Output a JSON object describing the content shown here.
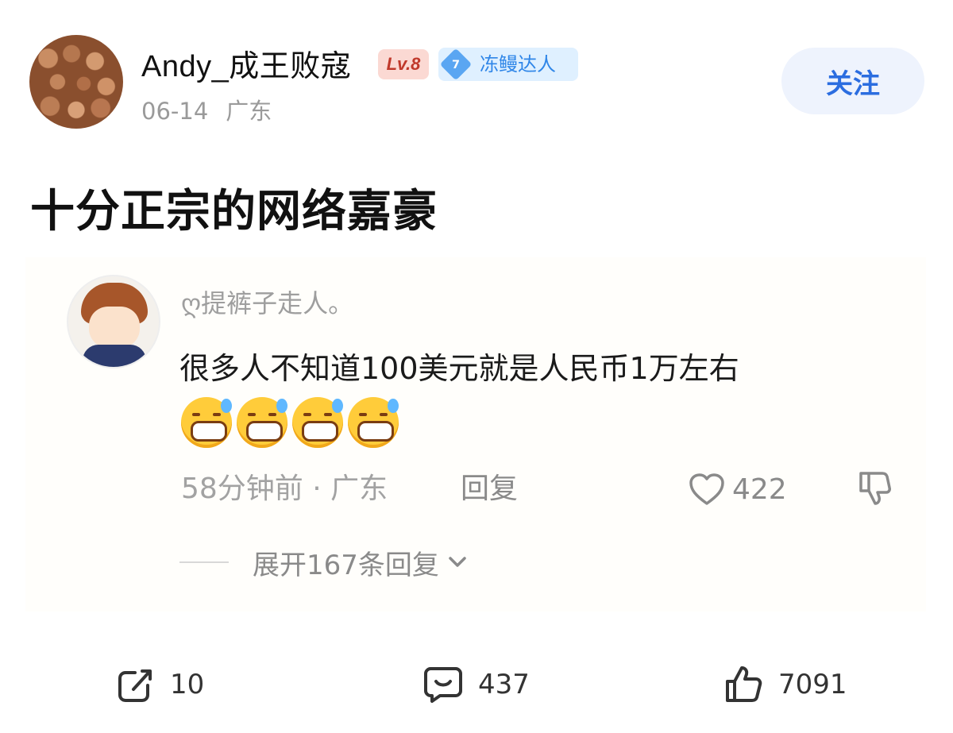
{
  "post": {
    "author": "Andy_成王败寇",
    "level_badge": "Lv.8",
    "fan_badge_level": "7",
    "fan_badge_label": "冻鳗达人",
    "date": "06-14",
    "location": "广东",
    "follow_label": "关注",
    "title": "十分正宗的网络嘉豪"
  },
  "comment": {
    "author": "ღ提裤子走人。",
    "text": "很多人不知道100美元就是人民币1万左右",
    "emoji_icon": "sweat-grin-emoji",
    "emoji_count": 4,
    "time_location": "58分钟前 · 广东",
    "reply_label": "回复",
    "like_count": "422",
    "expand_label": "展开167条回复"
  },
  "actions": {
    "share_count": "10",
    "comment_count": "437",
    "like_count": "7091"
  },
  "colors": {
    "accent_blue": "#2b6de0",
    "follow_bg": "#eef3fd",
    "level_badge_bg": "#fbd9d3",
    "fan_badge_bg": "#dff0ff"
  }
}
